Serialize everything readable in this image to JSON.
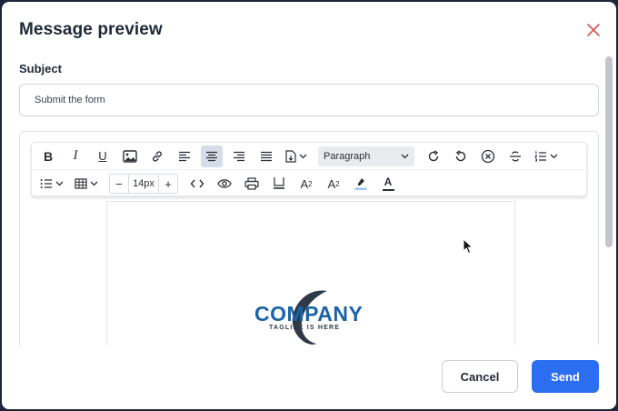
{
  "dialog": {
    "title": "Message preview"
  },
  "subject": {
    "label": "Subject",
    "value": "Submit the form"
  },
  "toolbar": {
    "bold": "B",
    "italic": "I",
    "underline": "U",
    "block_format": "Paragraph",
    "font_size": "14px",
    "decrease": "−",
    "increase": "+",
    "superscript_base": "A",
    "superscript_mark": "2",
    "subscript_base": "A",
    "subscript_mark": "2",
    "text_color_letter": "A"
  },
  "preview": {
    "logo_word": "COMPANY",
    "logo_tagline": "TAGLINE IS HERE"
  },
  "footer": {
    "cancel_label": "Cancel",
    "send_label": "Send"
  },
  "colors": {
    "accent": "#2b6ef2",
    "close": "#d9534f",
    "logo_blue": "#1c63a6",
    "highlight": "#9ec5ff",
    "text_color_bar": "#2b2f36"
  }
}
